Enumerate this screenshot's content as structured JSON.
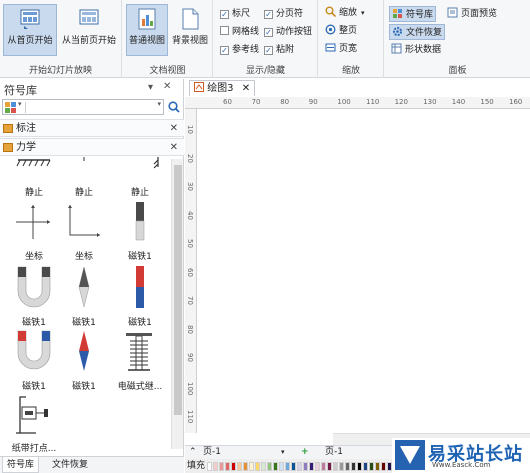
{
  "ribbon": {
    "groups": {
      "slideshow": {
        "label": "开始幻灯片放映",
        "btn1": "从首页开始",
        "btn2": "从当前页开始"
      },
      "docview": {
        "label": "文档视图",
        "btn1": "普通视图",
        "btn2": "背景视图"
      },
      "showhide": {
        "label": "显示/隐藏",
        "items": [
          {
            "label": "标尺",
            "checked": true
          },
          {
            "label": "分页符",
            "checked": true
          },
          {
            "label": "网格线",
            "checked": false
          },
          {
            "label": "动作按钮",
            "checked": true
          },
          {
            "label": "参考线",
            "checked": true
          },
          {
            "label": "粘附",
            "checked": true
          }
        ]
      },
      "zoom": {
        "label": "缩放",
        "zoom": "缩放",
        "page": "整页",
        "width": "页宽"
      },
      "panel": {
        "label": "面板",
        "symbols": "符号库",
        "recover": "文件恢复",
        "shapedata": "形状数据",
        "preview": "页面预览"
      }
    }
  },
  "panel": {
    "title": "符号库",
    "categories": [
      {
        "label": "标注"
      },
      {
        "label": "力学"
      }
    ],
    "shapes": [
      {
        "label": "静止",
        "icon": "static-icon"
      },
      {
        "label": "静止",
        "icon": "static-icon"
      },
      {
        "label": "静止",
        "icon": "static-icon"
      },
      {
        "label": "坐标",
        "icon": "axis-cross-icon"
      },
      {
        "label": "坐标",
        "icon": "axis-corner-icon"
      },
      {
        "label": "磁铁1",
        "icon": "bar-magnet-vertical-icon"
      },
      {
        "label": "磁铁1",
        "icon": "u-magnet-icon"
      },
      {
        "label": "磁铁1",
        "icon": "compass-needle-icon"
      },
      {
        "label": "磁铁1",
        "icon": "bar-magnet-red-blue-icon"
      },
      {
        "label": "磁铁1",
        "icon": "u-magnet-red-blue-icon"
      },
      {
        "label": "磁铁1",
        "icon": "compass-needle-red-blue-icon"
      },
      {
        "label": "电磁式继...",
        "icon": "coil-relay-icon"
      },
      {
        "label": "纸带打点...",
        "icon": "ticker-timer-icon"
      }
    ],
    "tabs": {
      "symbols": "符号库",
      "recover": "文件恢复"
    }
  },
  "doc": {
    "tab": "绘图3",
    "ruler_h": [
      "60",
      "70",
      "80",
      "90",
      "100",
      "110",
      "120",
      "130",
      "140",
      "150",
      "160"
    ],
    "ruler_v": [
      "10",
      "20",
      "30",
      "40",
      "50",
      "60",
      "70",
      "80",
      "90",
      "100",
      "110"
    ],
    "page_left": "页-1",
    "page_tab": "页-1",
    "fill_label": "填充"
  },
  "watermark": {
    "text": "易采站长站",
    "url": "Www.Easck.Com"
  },
  "colors": {
    "accent": "#2a6ab5",
    "selected": "#c9d9ee",
    "ribbon_bg": "#f6f7f9"
  }
}
